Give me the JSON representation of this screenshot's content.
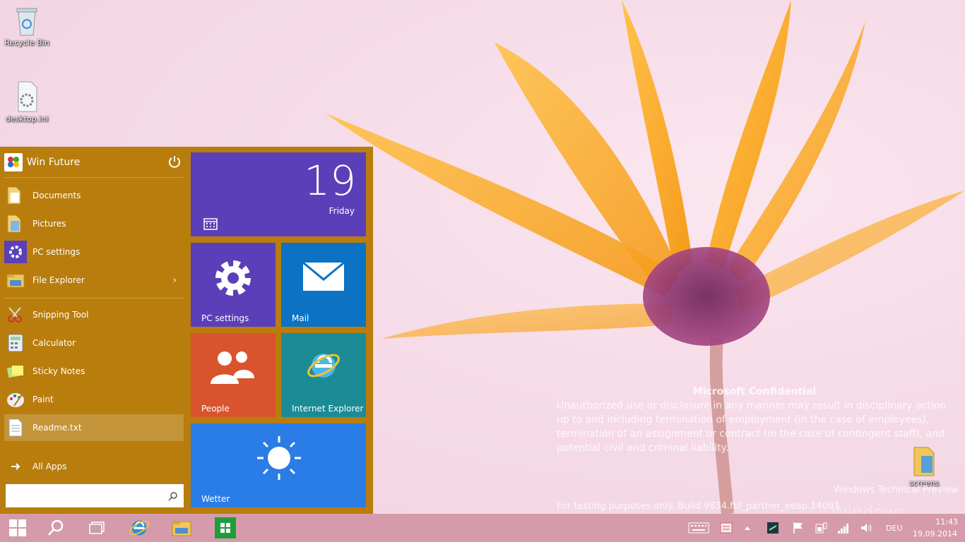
{
  "desktop": {
    "icons": [
      {
        "label": "Recycle Bin",
        "icon": "recycle-bin-icon"
      },
      {
        "label": "desktop.ini",
        "icon": "settings-file-icon"
      },
      {
        "label": "screens",
        "icon": "folder-icon"
      }
    ]
  },
  "watermark": {
    "title": "Microsoft Confidential",
    "body": "Unauthorized use or disclosure in any manner may result in disciplinary action up to and including termination of employment (in the case of employees), termination of an assignment or contract (in the case of contingent staff), and potential civil and criminal liability.",
    "build": "For testing purposes only. Build 9834.fbl_partner_eeap.14091",
    "preview": "Windows Technical Preview",
    "community": "Windows Community"
  },
  "start_menu": {
    "user_name": "Win Future",
    "background_color": "#b87d0d",
    "pinned": [
      {
        "label": "Documents",
        "icon": "documents-folder-icon"
      },
      {
        "label": "Pictures",
        "icon": "pictures-folder-icon"
      },
      {
        "label": "PC settings",
        "icon": "gear-icon"
      },
      {
        "label": "File Explorer",
        "icon": "file-explorer-icon",
        "has_submenu": true
      }
    ],
    "recent": [
      {
        "label": "Snipping Tool",
        "icon": "scissors-icon"
      },
      {
        "label": "Calculator",
        "icon": "calculator-icon"
      },
      {
        "label": "Sticky Notes",
        "icon": "sticky-notes-icon"
      },
      {
        "label": "Paint",
        "icon": "palette-icon"
      },
      {
        "label": "Readme.txt",
        "icon": "text-file-icon",
        "selected": true
      }
    ],
    "all_apps_label": "All Apps",
    "search_value": ""
  },
  "tiles": {
    "calendar": {
      "day": "19",
      "weekday": "Friday",
      "color": "#5a3fb8"
    },
    "pc_settings": {
      "label": "PC settings",
      "color": "#5a3fb8"
    },
    "mail": {
      "label": "Mail",
      "color": "#0b72c4"
    },
    "people": {
      "label": "People",
      "color": "#d9532c"
    },
    "internet_explorer": {
      "label": "Internet Explorer",
      "color": "#1b8b96"
    },
    "weather": {
      "label": "Wetter",
      "color": "#2a7ce6"
    }
  },
  "taskbar": {
    "language": "DEU",
    "time": "11:43",
    "date": "19.09.2014"
  }
}
